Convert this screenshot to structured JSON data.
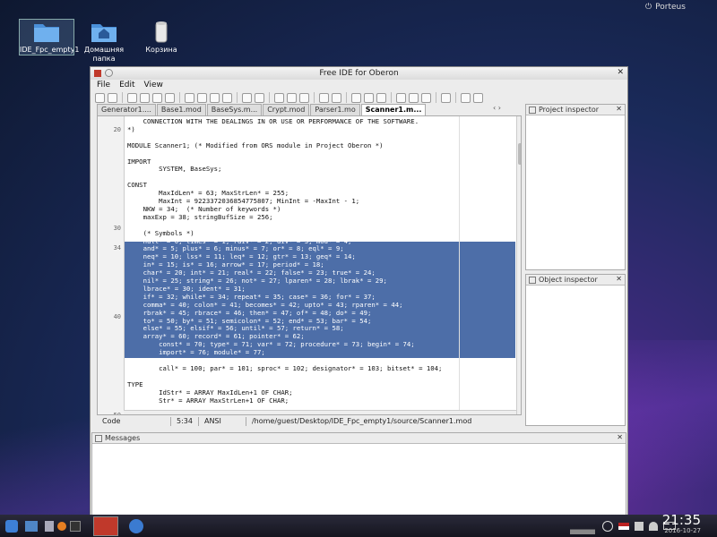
{
  "topbar": {
    "user": "Porteus"
  },
  "desktop_icons": [
    {
      "label": "IDE_Fpc_empty1"
    },
    {
      "label": "Домашняя папка"
    },
    {
      "label": "Корзина"
    }
  ],
  "window": {
    "title": "Free IDE for Oberon"
  },
  "menu": [
    "File",
    "Edit",
    "View"
  ],
  "tabs": [
    "Generator1....",
    "Base1.mod",
    "BaseSys.m...",
    "Crypt.mod",
    "Parser1.mo",
    "Scanner1.m..."
  ],
  "line_numbers": [
    "20",
    "30",
    "34",
    "40",
    "50"
  ],
  "code_lines": [
    "    CONNECTION WITH THE DEALINGS IN OR USE OR PERFORMANCE OF THE SOFTWARE.",
    "*)",
    "",
    "MODULE Scanner1; (* Modified from ORS module in Project Oberon *)",
    "",
    "IMPORT",
    "        SYSTEM, BaseSys;",
    "",
    "CONST",
    "        MaxIdLen* = 63; MaxStrLen* = 255;",
    "        MaxInt = 9223372036854775807; MinInt = -MaxInt - 1;",
    "    NKW = 34;  (* Number of keywords *)",
    "    maxExp = 38; stringBufSize = 256;",
    "",
    "    (* Symbols *)",
    "    null* = 0; times* = 1; rdiv* = 2; div* = 3; mod* = 4;",
    "    and* = 5; plus* = 6; minus* = 7; or* = 8; eql* = 9;",
    "    neq* = 10; lss* = 11; leq* = 12; gtr* = 13; geq* = 14;",
    "    in* = 15; is* = 16; arrow* = 17; period* = 18;",
    "    char* = 20; int* = 21; real* = 22; false* = 23; true* = 24;",
    "    nil* = 25; string* = 26; not* = 27; lparen* = 28; lbrak* = 29;",
    "    lbrace* = 30; ident* = 31;",
    "    if* = 32; while* = 34; repeat* = 35; case* = 36; for* = 37;",
    "    comma* = 40; colon* = 41; becomes* = 42; upto* = 43; rparen* = 44;",
    "    rbrak* = 45; rbrace* = 46; then* = 47; of* = 48; do* = 49;",
    "    to* = 50; by* = 51; semicolon* = 52; end* = 53; bar* = 54;",
    "    else* = 55; elsif* = 56; until* = 57; return* = 58;",
    "    array* = 60; record* = 61; pointer* = 62;",
    "        const* = 70; type* = 71; var* = 72; procedure* = 73; begin* = 74;",
    "        import* = 76; module* = 77;",
    "",
    "        call* = 100; par* = 101; sproc* = 102; designator* = 103; bitset* = 104;",
    "",
    "TYPE",
    "        IdStr* = ARRAY MaxIdLen+1 OF CHAR;",
    "        Str* = ARRAY MaxStrLen+1 OF CHAR;",
    "",
    "VAR"
  ],
  "status": {
    "mode": "Code",
    "position": "5:34",
    "encoding": "ANSI",
    "path": "/home/guest/Desktop/IDE_Fpc_empty1/source/Scanner1.mod"
  },
  "panels": {
    "project": "Project inspector",
    "object": "Object inspector",
    "messages": "Messages"
  },
  "clock": {
    "time": "21:35",
    "date": "2016-10-27"
  }
}
